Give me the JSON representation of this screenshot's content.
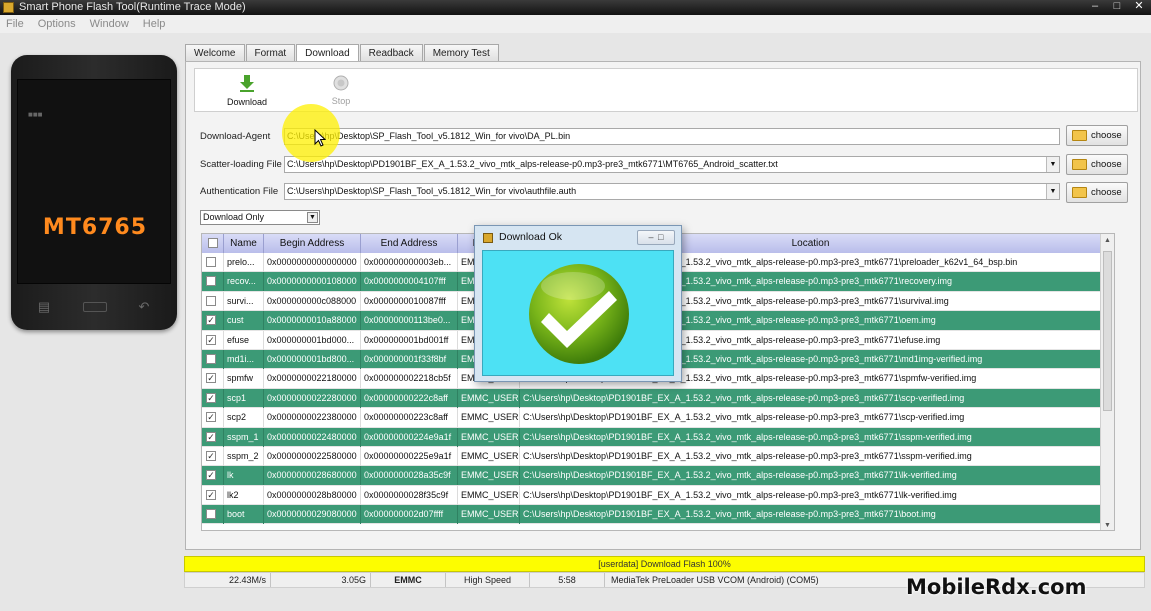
{
  "window": {
    "title": "Smart Phone Flash Tool(Runtime Trace Mode)"
  },
  "menu": [
    "File",
    "Options",
    "Window",
    "Help"
  ],
  "phone": {
    "chip": "MT6765"
  },
  "tabs": [
    {
      "label": "Welcome",
      "active": false
    },
    {
      "label": "Format",
      "active": false
    },
    {
      "label": "Download",
      "active": true
    },
    {
      "label": "Readback",
      "active": false
    },
    {
      "label": "Memory Test",
      "active": false
    }
  ],
  "toolbar": {
    "download_label": "Download",
    "stop_label": "Stop"
  },
  "fields": {
    "download_agent": {
      "label": "Download-Agent",
      "value": "C:\\Users\\hp\\Desktop\\SP_Flash_Tool_v5.1812_Win_for vivo\\DA_PL.bin"
    },
    "scatter": {
      "label": "Scatter-loading File",
      "value": "C:\\Users\\hp\\Desktop\\PD1901BF_EX_A_1.53.2_vivo_mtk_alps-release-p0.mp3-pre3_mtk6771\\MT6765_Android_scatter.txt"
    },
    "auth": {
      "label": "Authentication File",
      "value": "C:\\Users\\hp\\Desktop\\SP_Flash_Tool_v5.1812_Win_for vivo\\authfile.auth"
    },
    "choose_label": "choose"
  },
  "mode": {
    "selected": "Download Only"
  },
  "table": {
    "headers": [
      "Name",
      "Begin Address",
      "End Address",
      "Region",
      "Location"
    ],
    "rows": [
      {
        "checked": false,
        "hl": false,
        "name": "prelo...",
        "begin": "0x0000000000000000",
        "end": "0x000000000003eb...",
        "region": "EMMC_USER",
        "location": "C:\\Users\\hp\\Desktop\\PD1901BF_EX_A_1.53.2_vivo_mtk_alps-release-p0.mp3-pre3_mtk6771\\preloader_k62v1_64_bsp.bin"
      },
      {
        "checked": false,
        "hl": true,
        "name": "recov...",
        "begin": "0x0000000000108000",
        "end": "0x0000000004107fff",
        "region": "EMMC_USER",
        "location": "C:\\Users\\hp\\Desktop\\PD1901BF_EX_A_1.53.2_vivo_mtk_alps-release-p0.mp3-pre3_mtk6771\\recovery.img"
      },
      {
        "checked": false,
        "hl": false,
        "name": "survi...",
        "begin": "0x000000000c088000",
        "end": "0x0000000010087fff",
        "region": "EMMC_USER",
        "location": "C:\\Users\\hp\\Desktop\\PD1901BF_EX_A_1.53.2_vivo_mtk_alps-release-p0.mp3-pre3_mtk6771\\survival.img"
      },
      {
        "checked": true,
        "hl": true,
        "name": "cust",
        "begin": "0x0000000010a88000",
        "end": "0x00000000113be0...",
        "region": "EMMC_USER",
        "location": "C:\\Users\\hp\\Desktop\\PD1901BF_EX_A_1.53.2_vivo_mtk_alps-release-p0.mp3-pre3_mtk6771\\oem.img"
      },
      {
        "checked": true,
        "hl": false,
        "name": "efuse",
        "begin": "0x000000001bd000...",
        "end": "0x000000001bd001ff",
        "region": "EMMC_USER",
        "location": "C:\\Users\\hp\\Desktop\\PD1901BF_EX_A_1.53.2_vivo_mtk_alps-release-p0.mp3-pre3_mtk6771\\efuse.img"
      },
      {
        "checked": false,
        "hl": true,
        "name": "md1i...",
        "begin": "0x000000001bd800...",
        "end": "0x000000001f33f8bf",
        "region": "EMMC_USER",
        "location": "C:\\Users\\hp\\Desktop\\PD1901BF_EX_A_1.53.2_vivo_mtk_alps-release-p0.mp3-pre3_mtk6771\\md1img-verified.img"
      },
      {
        "checked": true,
        "hl": false,
        "name": "spmfw",
        "begin": "0x0000000022180000",
        "end": "0x000000002218cb5f",
        "region": "EMMC_USER",
        "location": "C:\\Users\\hp\\Desktop\\PD1901BF_EX_A_1.53.2_vivo_mtk_alps-release-p0.mp3-pre3_mtk6771\\spmfw-verified.img"
      },
      {
        "checked": true,
        "hl": true,
        "name": "scp1",
        "begin": "0x0000000022280000",
        "end": "0x00000000222c8aff",
        "region": "EMMC_USER",
        "location": "C:\\Users\\hp\\Desktop\\PD1901BF_EX_A_1.53.2_vivo_mtk_alps-release-p0.mp3-pre3_mtk6771\\scp-verified.img"
      },
      {
        "checked": true,
        "hl": false,
        "name": "scp2",
        "begin": "0x0000000022380000",
        "end": "0x00000000223c8aff",
        "region": "EMMC_USER",
        "location": "C:\\Users\\hp\\Desktop\\PD1901BF_EX_A_1.53.2_vivo_mtk_alps-release-p0.mp3-pre3_mtk6771\\scp-verified.img"
      },
      {
        "checked": true,
        "hl": true,
        "name": "sspm_1",
        "begin": "0x0000000022480000",
        "end": "0x00000000224e9a1f",
        "region": "EMMC_USER",
        "location": "C:\\Users\\hp\\Desktop\\PD1901BF_EX_A_1.53.2_vivo_mtk_alps-release-p0.mp3-pre3_mtk6771\\sspm-verified.img"
      },
      {
        "checked": true,
        "hl": false,
        "name": "sspm_2",
        "begin": "0x0000000022580000",
        "end": "0x00000000225e9a1f",
        "region": "EMMC_USER",
        "location": "C:\\Users\\hp\\Desktop\\PD1901BF_EX_A_1.53.2_vivo_mtk_alps-release-p0.mp3-pre3_mtk6771\\sspm-verified.img"
      },
      {
        "checked": true,
        "hl": true,
        "name": "lk",
        "begin": "0x0000000028680000",
        "end": "0x0000000028a35c9f",
        "region": "EMMC_USER",
        "location": "C:\\Users\\hp\\Desktop\\PD1901BF_EX_A_1.53.2_vivo_mtk_alps-release-p0.mp3-pre3_mtk6771\\lk-verified.img"
      },
      {
        "checked": true,
        "hl": false,
        "name": "lk2",
        "begin": "0x0000000028b80000",
        "end": "0x0000000028f35c9f",
        "region": "EMMC_USER",
        "location": "C:\\Users\\hp\\Desktop\\PD1901BF_EX_A_1.53.2_vivo_mtk_alps-release-p0.mp3-pre3_mtk6771\\lk-verified.img"
      },
      {
        "checked": false,
        "hl": true,
        "name": "boot",
        "begin": "0x0000000029080000",
        "end": "0x000000002d07ffff",
        "region": "EMMC_USER",
        "location": "C:\\Users\\hp\\Desktop\\PD1901BF_EX_A_1.53.2_vivo_mtk_alps-release-p0.mp3-pre3_mtk6771\\boot.img"
      }
    ]
  },
  "dialog": {
    "title": "Download Ok"
  },
  "progress": {
    "text": "[userdata] Download Flash 100%",
    "percent": 100
  },
  "status": [
    "22.43M/s",
    "3.05G",
    "EMMC",
    "High Speed",
    "5:58",
    "MediaTek PreLoader USB VCOM (Android) (COM5)"
  ],
  "watermark": "MobileRdx.com",
  "colors": {
    "highlight_row": "#3c9a76",
    "dialog_body": "#4de1f4",
    "progress_bar": "#fdfd00",
    "chip_text": "#ff8a1e"
  }
}
